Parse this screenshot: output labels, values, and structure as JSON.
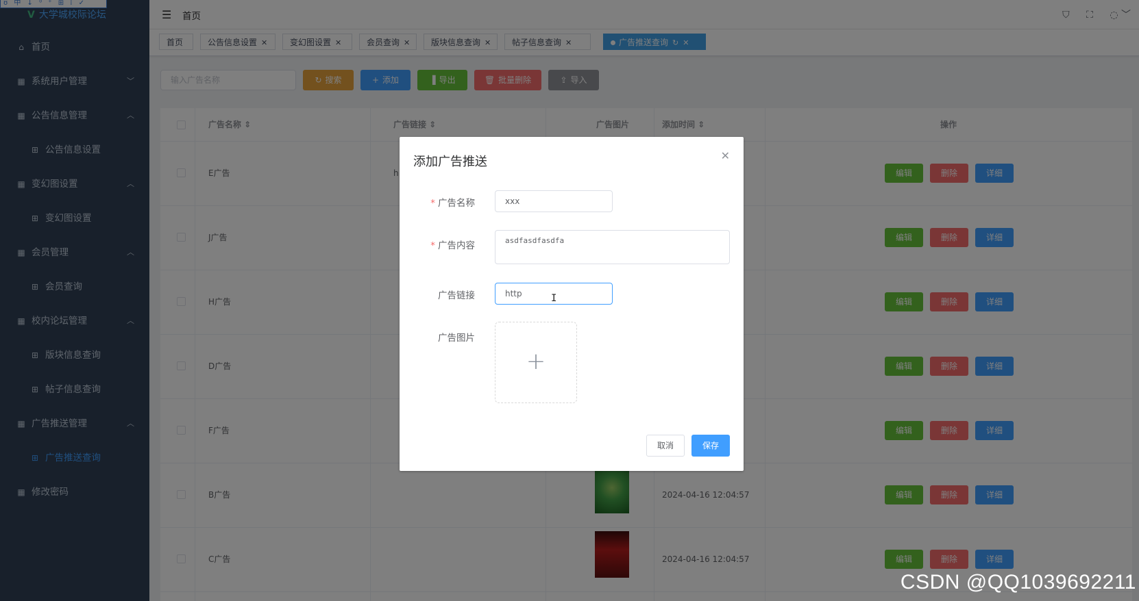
{
  "app": {
    "logo_text": "大学城校际论坛",
    "ime_bar": "ʊ 中 ↓ ⁰ ⁺ ⊞ ⁞ ✓"
  },
  "sidebar": {
    "items": [
      {
        "label": "首页",
        "type": "top",
        "icon": "home-icon"
      },
      {
        "label": "系统用户管理",
        "type": "group",
        "arrow": "﹀"
      },
      {
        "label": "公告信息管理",
        "type": "group",
        "arrow": "︿"
      },
      {
        "label": "公告信息设置",
        "type": "sub"
      },
      {
        "label": "变幻图设置",
        "type": "group",
        "arrow": "︿"
      },
      {
        "label": "变幻图设置",
        "type": "sub"
      },
      {
        "label": "会员管理",
        "type": "group",
        "arrow": "︿"
      },
      {
        "label": "会员查询",
        "type": "sub"
      },
      {
        "label": "校内论坛管理",
        "type": "group",
        "arrow": "︿"
      },
      {
        "label": "版块信息查询",
        "type": "sub"
      },
      {
        "label": "帖子信息查询",
        "type": "sub"
      },
      {
        "label": "广告推送管理",
        "type": "group",
        "arrow": "︿"
      },
      {
        "label": "广告推送查询",
        "type": "sub",
        "active": true
      },
      {
        "label": "修改密码",
        "type": "top"
      }
    ]
  },
  "header": {
    "breadcrumb": "首页"
  },
  "tabs": [
    {
      "label": "首页"
    },
    {
      "label": "公告信息设置"
    },
    {
      "label": "变幻图设置"
    },
    {
      "label": "会员查询"
    },
    {
      "label": "版块信息查询"
    },
    {
      "label": "帖子信息查询"
    },
    {
      "label": "广告推送查询",
      "active": true
    }
  ],
  "toolbar": {
    "search_placeholder": "输入广告名称",
    "buttons": [
      {
        "label": "搜索",
        "icon": "↻",
        "color": "#e6a23c"
      },
      {
        "label": "添加",
        "icon": "+",
        "color": "#409eff"
      },
      {
        "label": "导出",
        "icon": "▐",
        "color": "#67c23a"
      },
      {
        "label": "批量删除",
        "icon": "🗑",
        "color": "#f56c6c"
      },
      {
        "label": "导入",
        "icon": "⇪",
        "color": "#909399"
      }
    ]
  },
  "table": {
    "headers": [
      "广告名称",
      "广告链接",
      "广告图片",
      "添加时间",
      "操作"
    ],
    "rows": [
      {
        "name": "E广告",
        "link": "h",
        "time": ""
      },
      {
        "name": "J广告",
        "link": "",
        "time": ""
      },
      {
        "name": "H广告",
        "link": "",
        "time": ""
      },
      {
        "name": "D广告",
        "link": "",
        "time": ""
      },
      {
        "name": "F广告",
        "link": "",
        "time": ""
      },
      {
        "name": "B广告",
        "link": "",
        "time": "2024-04-16 12:04:57",
        "thumb": "green"
      },
      {
        "name": "C广告",
        "link": "",
        "time": "2024-04-16 12:04:57",
        "thumb": "red"
      }
    ],
    "op_labels": {
      "edit": "编辑",
      "delete": "删除",
      "detail": "详细"
    }
  },
  "dialog": {
    "title": "添加广告推送",
    "fields": {
      "name_label": "广告名称",
      "name_value": "xxx",
      "content_label": "广告内容",
      "content_value": "asdfasdfasdfa",
      "link_label": "广告链接",
      "link_value": "http",
      "image_label": "广告图片"
    },
    "cancel_label": "取消",
    "save_label": "保存"
  },
  "watermark": "CSDN @QQ1039692211",
  "colors": {
    "sidebar_bg": "#304156",
    "primary": "#409eff",
    "success": "#67c23a",
    "danger": "#f56c6c",
    "warning": "#e6a23c"
  }
}
